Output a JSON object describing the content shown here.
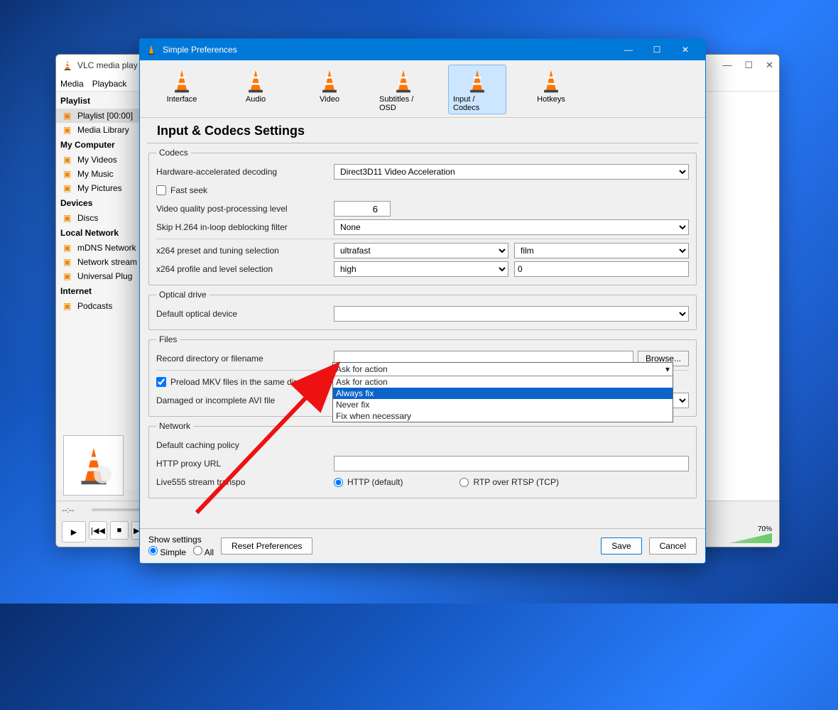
{
  "vlc_main": {
    "title": "VLC media play",
    "menus": [
      "Media",
      "Playback"
    ],
    "sidebar": {
      "groups": [
        {
          "header": "Playlist",
          "items": [
            {
              "label": "Playlist [00:00]",
              "sel": true
            },
            {
              "label": "Media Library"
            }
          ]
        },
        {
          "header": "My Computer",
          "items": [
            {
              "label": "My Videos"
            },
            {
              "label": "My Music"
            },
            {
              "label": "My Pictures"
            }
          ]
        },
        {
          "header": "Devices",
          "items": [
            {
              "label": "Discs"
            }
          ]
        },
        {
          "header": "Local Network",
          "items": [
            {
              "label": "mDNS Network"
            },
            {
              "label": "Network stream"
            },
            {
              "label": "Universal Plug"
            }
          ]
        },
        {
          "header": "Internet",
          "items": [
            {
              "label": "Podcasts"
            }
          ]
        }
      ]
    },
    "time": "--:--",
    "volume": "70%"
  },
  "prefs": {
    "title": "Simple Preferences",
    "tabs": [
      "Interface",
      "Audio",
      "Video",
      "Subtitles / OSD",
      "Input / Codecs",
      "Hotkeys"
    ],
    "tab_selected": 4,
    "heading": "Input & Codecs Settings",
    "codecs": {
      "legend": "Codecs",
      "hw_label": "Hardware-accelerated decoding",
      "hw_value": "Direct3D11 Video Acceleration",
      "fast_seek": "Fast seek",
      "fast_seek_checked": false,
      "pp_label": "Video quality post-processing level",
      "pp_value": "6",
      "skip_label": "Skip H.264 in-loop deblocking filter",
      "skip_value": "None",
      "x264p_label": "x264 preset and tuning selection",
      "x264p_preset": "ultrafast",
      "x264p_tune": "film",
      "x264l_label": "x264 profile and level selection",
      "x264l_profile": "high",
      "x264l_level": "0"
    },
    "optical": {
      "legend": "Optical drive",
      "label": "Default optical device",
      "value": ""
    },
    "files": {
      "legend": "Files",
      "record_label": "Record directory or filename",
      "record_value": "",
      "browse": "Browse...",
      "preload": "Preload MKV files in the same directory",
      "preload_checked": true,
      "avi_label": "Damaged or incomplete AVI file",
      "avi_selected": "Ask for action",
      "avi_options": [
        "Ask for action",
        "Always fix",
        "Never fix",
        "Fix when necessary"
      ],
      "avi_highlight": 1
    },
    "network": {
      "legend": "Network",
      "cache_label": "Default caching policy",
      "proxy_label": "HTTP proxy URL",
      "proxy_value": "",
      "live_label": "Live555 stream transpo",
      "radio_http": "HTTP (default)",
      "radio_rtp": "RTP over RTSP (TCP)"
    },
    "footer": {
      "show_label": "Show settings",
      "simple": "Simple",
      "all": "All",
      "reset": "Reset Preferences",
      "save": "Save",
      "cancel": "Cancel"
    }
  }
}
